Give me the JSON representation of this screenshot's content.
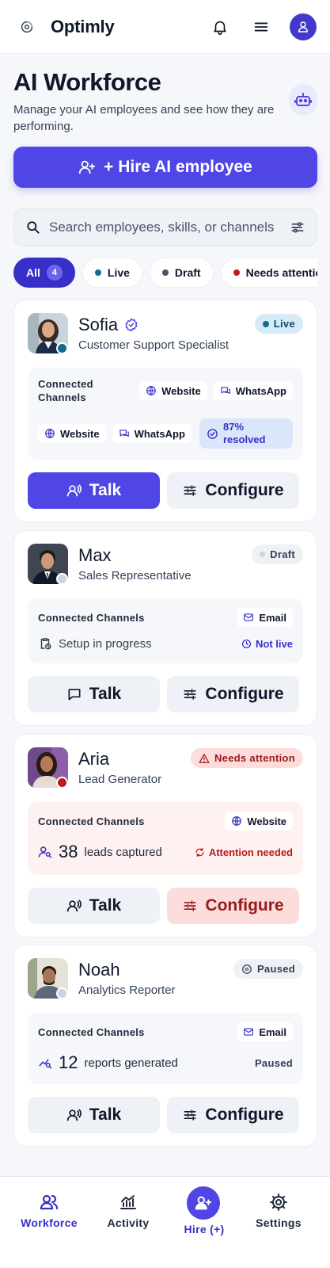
{
  "app": {
    "name": "Optimly"
  },
  "header": {
    "title": "AI Workforce",
    "subtitle": "Manage your AI employees and see how they are performing.",
    "hire_label": "+ Hire AI employee"
  },
  "search": {
    "placeholder": "Search employees, skills, or channels"
  },
  "filters": [
    {
      "label": "All",
      "count": "4"
    },
    {
      "label": "Live",
      "color": "#0e6e8c"
    },
    {
      "label": "Draft",
      "color": "#475569"
    },
    {
      "label": "Needs attention",
      "color": "#b91c1c"
    }
  ],
  "employees": [
    {
      "name": "Sofia",
      "verified": true,
      "role": "Customer Support Specialist",
      "status": "Live",
      "status_color": "#0e6e8c",
      "channels_label": "Connected Channels",
      "channels_top": [
        "Website",
        "WhatsApp"
      ],
      "channels_bottom": [
        "Website",
        "WhatsApp"
      ],
      "metric": "87% resolved",
      "talk": "Talk",
      "configure": "Configure"
    },
    {
      "name": "Max",
      "role": "Sales Representative",
      "status": "Draft",
      "channels_label": "Connected Channels",
      "channel": "Email",
      "info": "Setup in progress",
      "info_right": "Not live",
      "talk": "Talk",
      "configure": "Configure"
    },
    {
      "name": "Aria",
      "role": "Lead Generator",
      "status": "Needs attention",
      "status_color": "#b91c1c",
      "channels_label": "Connected Channels",
      "channel": "Website",
      "metric_value": "38",
      "metric_label": "leads captured",
      "info_right": "Attention needed",
      "talk": "Talk",
      "configure": "Configure"
    },
    {
      "name": "Noah",
      "role": "Analytics Reporter",
      "status": "Paused",
      "channels_label": "Connected Channels",
      "channel": "Email",
      "metric_value": "12",
      "metric_label": "reports generated",
      "info_right": "Paused",
      "talk": "Talk",
      "configure": "Configure"
    }
  ],
  "nav": [
    {
      "label": "Workforce"
    },
    {
      "label": "Activity"
    },
    {
      "label": "Hire (+)"
    },
    {
      "label": "Settings"
    }
  ],
  "colors": {
    "accent": "#4f46e5",
    "accent_dark": "#3730c8",
    "danger": "#b91c1c"
  }
}
